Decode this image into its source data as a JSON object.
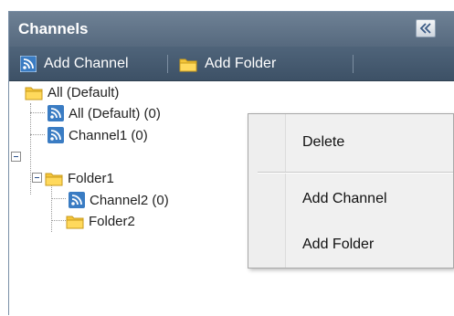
{
  "panel": {
    "title": "Channels",
    "collapse_icon": "double-chevron-left-icon"
  },
  "toolbar": {
    "add_channel_label": "Add Channel",
    "add_folder_label": "Add Folder"
  },
  "tree": {
    "root": {
      "label": "All (Default)",
      "expanded": true
    },
    "items": [
      {
        "label": "All (Default) (0)",
        "type": "channel"
      },
      {
        "label": "Channel1 (0)",
        "type": "channel"
      },
      {
        "label": "Folder1",
        "type": "folder",
        "expanded": true
      },
      {
        "label": "Channel2 (0)",
        "type": "channel"
      },
      {
        "label": "Folder2",
        "type": "folder"
      }
    ]
  },
  "context_menu": {
    "items": [
      {
        "label": "Delete"
      },
      {
        "label": "Add Channel"
      },
      {
        "label": "Add Folder"
      }
    ]
  },
  "colors": {
    "header_bg": "#6e8195",
    "toolbar_bg": "#4f647a",
    "rss_icon": "#3a7cc3",
    "folder_icon": "#f5c63a",
    "menu_bg": "#f0f0f0"
  }
}
